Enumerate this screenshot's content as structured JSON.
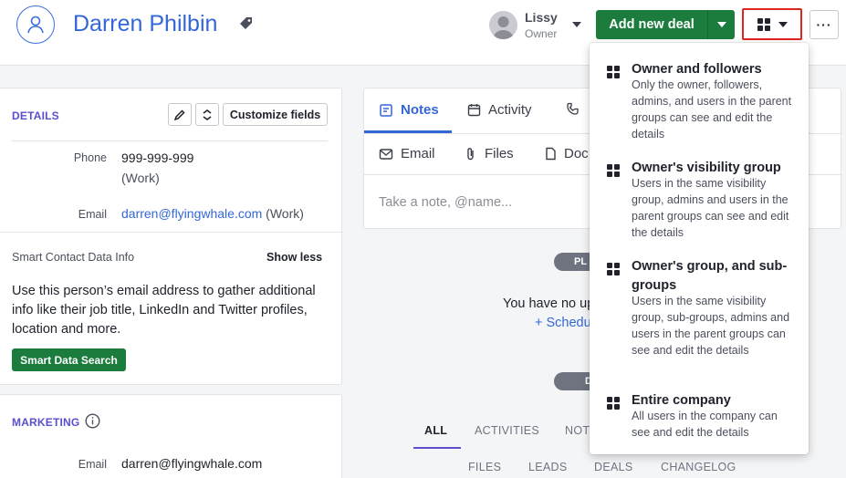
{
  "header": {
    "person_name": "Darren Philbin",
    "owner_name": "Lissy",
    "owner_role": "Owner",
    "add_deal_label": "Add new deal",
    "more_label": "···"
  },
  "details": {
    "title": "DETAILS",
    "customize_label": "Customize fields",
    "phone_label": "Phone",
    "phone_value": "999-999-999",
    "phone_type": "(Work)",
    "email_label": "Email",
    "email_value": "darren@flyingwhale.com",
    "email_type": "(Work)",
    "smart_title": "Smart Contact Data Info",
    "show_less": "Show less",
    "smart_desc": "Use this person’s email address to gather additional info like their job title, LinkedIn and Twitter profiles, location and more.",
    "smart_button": "Smart Data Search"
  },
  "marketing": {
    "title": "MARKETING",
    "email_label": "Email",
    "email_value": "darren@flyingwhale.com"
  },
  "notes_panel": {
    "tabs": [
      "Notes",
      "Activity"
    ],
    "tabs2": [
      "Email",
      "Files",
      "Doc"
    ],
    "placeholder": "Take a note, @name..."
  },
  "timeline": {
    "pill_planned": "PL",
    "pill_done": "D",
    "empty_text": "You have no up",
    "schedule_link": "+ Schedu",
    "history_tabs": [
      "ALL",
      "ACTIVITIES",
      "NOT"
    ],
    "history_tabs2": [
      "FILES",
      "LEADS",
      "DEALS",
      "CHANGELOG"
    ]
  },
  "visibility_menu": {
    "items": [
      {
        "title": "Owner and followers",
        "desc": "Only the owner, followers, admins, and users in the parent groups can see and edit the details"
      },
      {
        "title": "Owner's visibility group",
        "desc": "Users in the same visibility group, admins and users in the parent groups can see and edit the details"
      },
      {
        "title": "Owner's group, and sub-groups",
        "desc": "Users in the same visibility group, sub-groups, admins and users in the parent groups can see and edit the details"
      },
      {
        "title": "Entire company",
        "desc": "All users in the company can see and edit the details"
      }
    ]
  },
  "colors": {
    "brand_blue": "#3467d6",
    "green": "#1c7c3e",
    "highlight_red": "#e0241f",
    "section_purple": "#5a4fcf"
  }
}
